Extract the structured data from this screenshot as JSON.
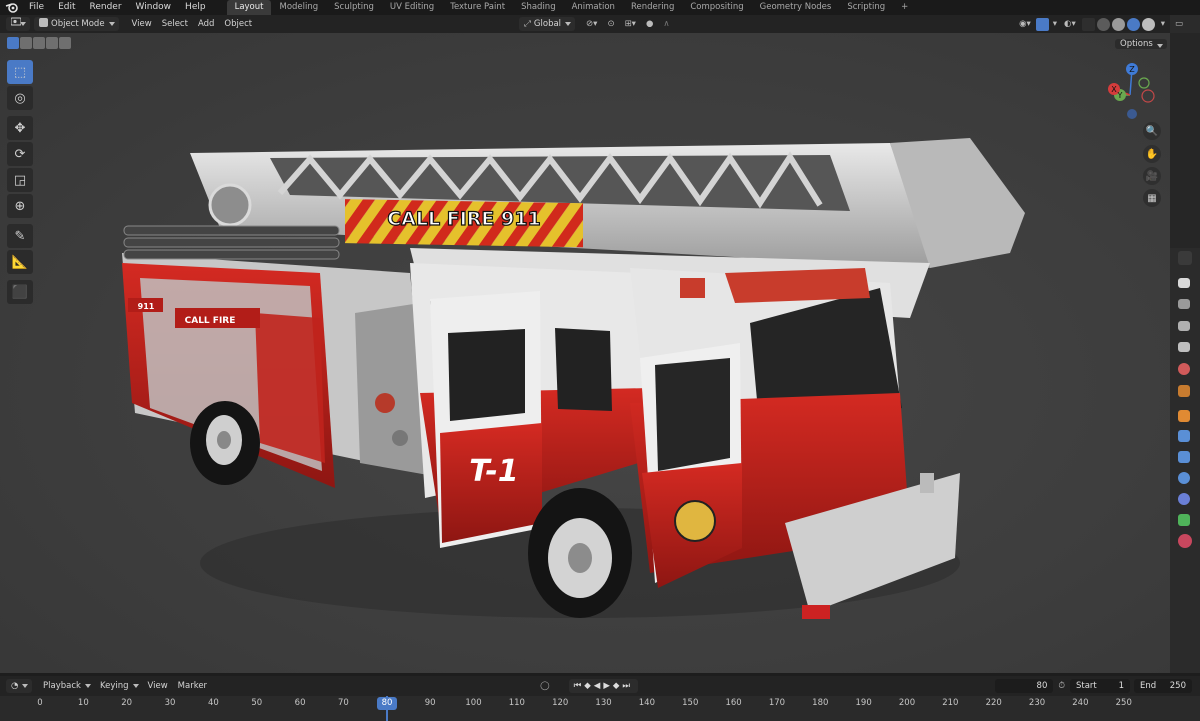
{
  "menu": [
    "File",
    "Edit",
    "Render",
    "Window",
    "Help"
  ],
  "workspaces": [
    "Layout",
    "Modeling",
    "Sculpting",
    "UV Editing",
    "Texture Paint",
    "Shading",
    "Animation",
    "Rendering",
    "Compositing",
    "Geometry Nodes",
    "Scripting"
  ],
  "active_workspace": "Layout",
  "add_tab_label": "+",
  "header": {
    "mode": "Object Mode",
    "menus": [
      "View",
      "Select",
      "Add",
      "Object"
    ],
    "orientation": "Global",
    "options_label": "Options"
  },
  "gizmo": {
    "z": "Z",
    "y": "Y",
    "x": "X"
  },
  "model": {
    "ladder_sign": "CALL FIRE 911",
    "side_text": "CALL FIRE",
    "side_number": "911",
    "door_text": "T-1"
  },
  "timeline": {
    "menus": [
      "Playback",
      "Keying",
      "View",
      "Marker"
    ],
    "current_frame": "80",
    "start_label": "Start",
    "start_value": "1",
    "end_label": "End",
    "end_value": "250",
    "ticks": [
      "0",
      "10",
      "20",
      "30",
      "40",
      "50",
      "60",
      "70",
      "80",
      "90",
      "100",
      "110",
      "120",
      "130",
      "140",
      "150",
      "160",
      "170",
      "180",
      "190",
      "200",
      "210",
      "220",
      "230",
      "240",
      "250"
    ]
  },
  "colors": {
    "accent": "#4a7ac6",
    "truck_red": "#c8201c",
    "playhead": "#4a7ac6"
  }
}
